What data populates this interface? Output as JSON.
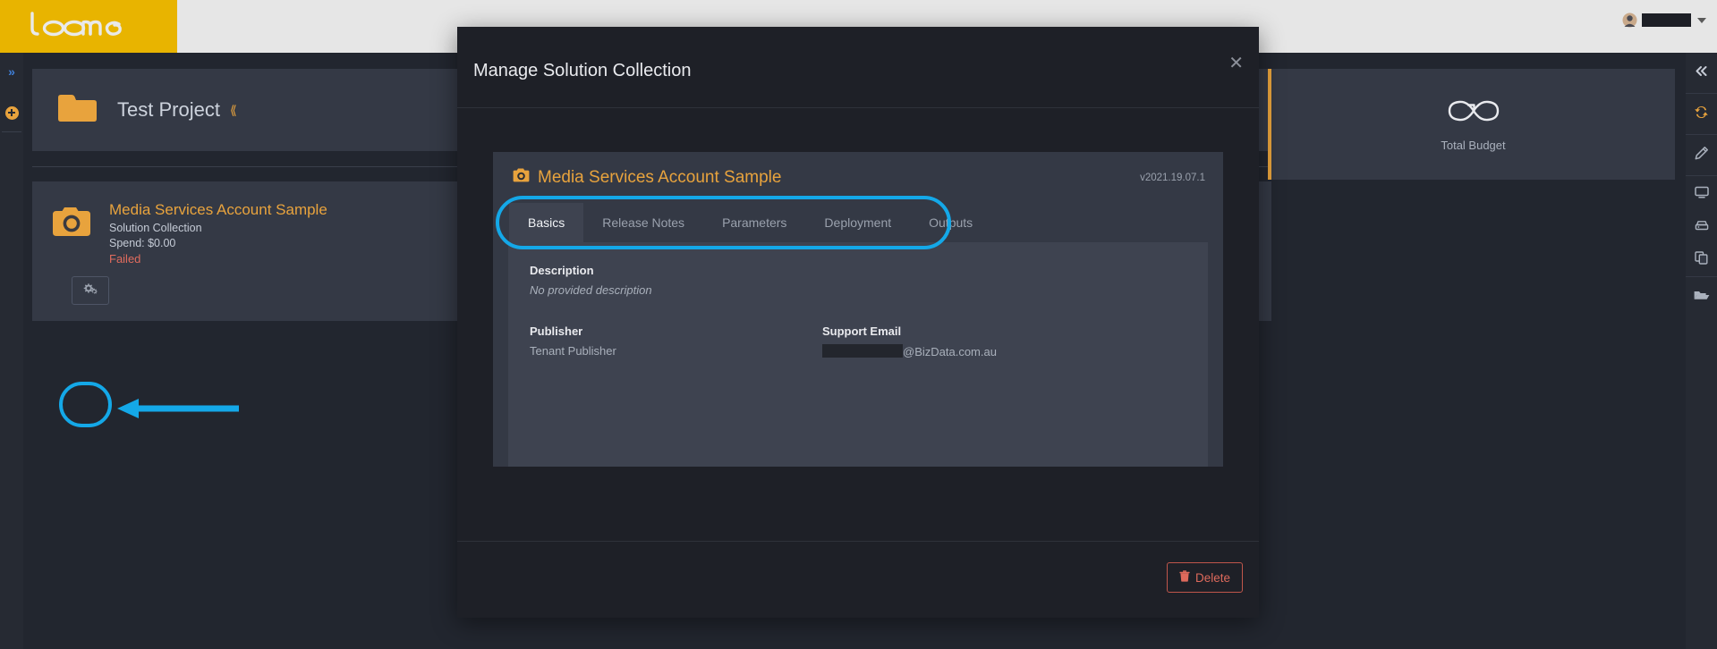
{
  "brand": {
    "name": "loome",
    "logo_icon": "loome-wordmark"
  },
  "topbar": {
    "user": {
      "avatar_icon": "user-avatar-icon",
      "name_redacted": "",
      "caret_icon": "chevron-down-icon"
    }
  },
  "left_rail": {
    "items": [
      {
        "name": "expand-panel",
        "icon": "double-chevron-right-icon"
      },
      {
        "name": "add-new",
        "icon": "plus-circle-icon"
      }
    ]
  },
  "right_rail": {
    "items": [
      {
        "name": "collapse-panel",
        "icon": "double-chevron-left-icon"
      },
      {
        "name": "refresh",
        "icon": "refresh-icon"
      },
      {
        "name": "edit",
        "icon": "pencil-icon"
      },
      {
        "name": "monitor",
        "icon": "monitor-icon"
      },
      {
        "name": "server",
        "icon": "server-icon"
      },
      {
        "name": "copy",
        "icon": "copy-icon"
      },
      {
        "name": "folder",
        "icon": "open-folder-icon"
      }
    ]
  },
  "project": {
    "name": "Test Project",
    "folder_icon": "folder-icon",
    "caret_icon": "chevron-down-icon"
  },
  "solution": {
    "icon": "camera-icon",
    "title": "Media Services Account Sample",
    "subtitle": "Solution Collection",
    "spend": "Spend: $0.00",
    "status": "Failed",
    "manage_button_icon": "cogs-icon"
  },
  "budget": {
    "icon": "infinity-icon",
    "label": "Total Budget"
  },
  "modal": {
    "title": "Manage Solution Collection",
    "close_icon": "close-icon",
    "card": {
      "icon": "camera-icon",
      "title": "Media Services Account Sample",
      "version": "v2021.19.07.1"
    },
    "tabs": [
      {
        "label": "Basics",
        "active": true
      },
      {
        "label": "Release Notes",
        "active": false
      },
      {
        "label": "Parameters",
        "active": false
      },
      {
        "label": "Deployment",
        "active": false
      },
      {
        "label": "Outputs",
        "active": false
      }
    ],
    "basics": {
      "description_label": "Description",
      "description_value": "No provided description",
      "publisher_label": "Publisher",
      "publisher_value": "Tenant Publisher",
      "support_email_label": "Support Email",
      "support_email_redacted": "",
      "support_email_domain": "@BizData.com.au"
    },
    "footer": {
      "delete_label": "Delete",
      "delete_icon": "trash-icon"
    }
  },
  "annotations": {
    "highlight_color": "#14a8e8",
    "cog_highlight": "circle",
    "arrow": "left-arrow"
  },
  "colors": {
    "brand_yellow": "#e8b400",
    "accent_orange": "#e8a33d",
    "danger_red": "#e06c5e",
    "panel": "#343945",
    "panel_light": "#3e4350",
    "app_bg": "#22262f",
    "modal_bg": "#1e2027"
  }
}
